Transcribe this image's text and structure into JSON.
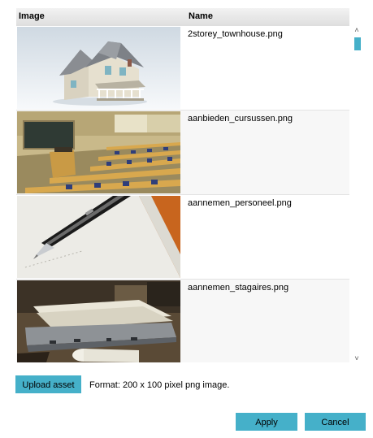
{
  "grid": {
    "columns": {
      "image": "Image",
      "name": "Name"
    },
    "rows": [
      {
        "filename": "2storey_townhouse.png",
        "thumbnail": "house"
      },
      {
        "filename": "aanbieden_cursussen.png",
        "thumbnail": "classroom"
      },
      {
        "filename": "aannemen_personeel.png",
        "thumbnail": "pen-on-paper"
      },
      {
        "filename": "aannemen_stagaires.png",
        "thumbnail": "laptop-with-papers"
      }
    ]
  },
  "scrollbar": {
    "up_glyph": "˄",
    "down_glyph": "˅"
  },
  "actions": {
    "upload_label": "Upload asset",
    "format_text": "Format: 200 x 100 pixel png image.",
    "apply_label": "Apply",
    "cancel_label": "Cancel"
  },
  "colors": {
    "accent": "#45b0c9",
    "header_bg": "#e6e6e6",
    "row_alt_bg": "#f7f7f7"
  }
}
